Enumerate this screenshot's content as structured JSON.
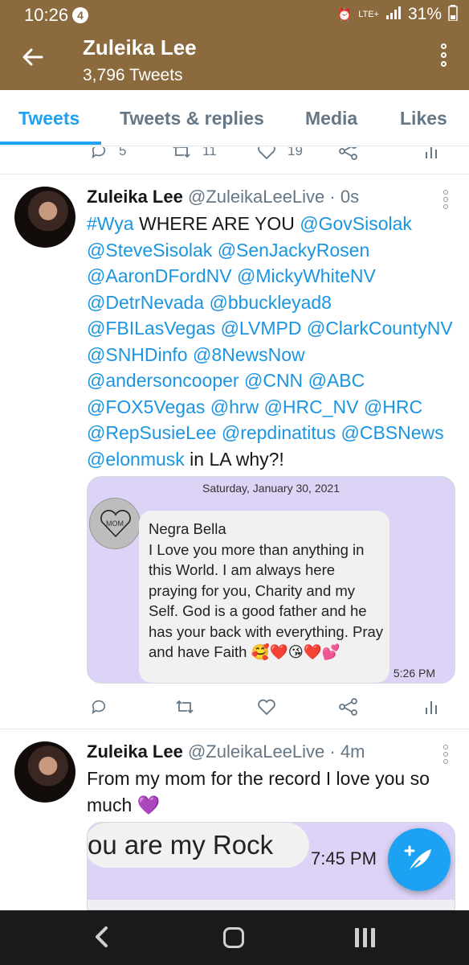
{
  "status_bar": {
    "time": "10:26",
    "notification_count": "4",
    "network": "LTE+",
    "battery": "31%"
  },
  "header": {
    "title": "Zuleika Lee",
    "subtitle": "3,796 Tweets"
  },
  "tabs": [
    {
      "label": "Tweets",
      "active": true
    },
    {
      "label": "Tweets & replies",
      "active": false
    },
    {
      "label": "Media",
      "active": false
    },
    {
      "label": "Likes",
      "active": false
    }
  ],
  "prev_tweet_actions": {
    "replies": "5",
    "retweets": "11",
    "likes": "19"
  },
  "tweet1": {
    "name": "Zuleika Lee",
    "handle": "@ZuleikaLeeLive",
    "time": "· 0s",
    "segments": [
      {
        "text": "#Wya",
        "link": true
      },
      {
        "text": " WHERE ARE YOU ",
        "link": false
      },
      {
        "text": "@GovSisolak",
        "link": true
      },
      {
        "text": " ",
        "link": false
      },
      {
        "text": "@SteveSisolak",
        "link": true
      },
      {
        "text": " ",
        "link": false
      },
      {
        "text": "@SenJackyRosen",
        "link": true
      },
      {
        "text": " ",
        "link": false
      },
      {
        "text": "@AaronDFordNV",
        "link": true
      },
      {
        "text": " ",
        "link": false
      },
      {
        "text": "@MickyWhiteNV",
        "link": true
      },
      {
        "text": " ",
        "link": false
      },
      {
        "text": "@DetrNevada",
        "link": true
      },
      {
        "text": " ",
        "link": false
      },
      {
        "text": "@bbuckleyad8",
        "link": true
      },
      {
        "text": " ",
        "link": false
      },
      {
        "text": "@FBILasVegas",
        "link": true
      },
      {
        "text": " ",
        "link": false
      },
      {
        "text": "@LVMPD",
        "link": true
      },
      {
        "text": " ",
        "link": false
      },
      {
        "text": "@ClarkCountyNV",
        "link": true
      },
      {
        "text": " ",
        "link": false
      },
      {
        "text": "@SNHDinfo",
        "link": true
      },
      {
        "text": " ",
        "link": false
      },
      {
        "text": "@8NewsNow",
        "link": true
      },
      {
        "text": " ",
        "link": false
      },
      {
        "text": "@andersoncooper",
        "link": true
      },
      {
        "text": " ",
        "link": false
      },
      {
        "text": "@CNN",
        "link": true
      },
      {
        "text": " ",
        "link": false
      },
      {
        "text": "@ABC",
        "link": true
      },
      {
        "text": " ",
        "link": false
      },
      {
        "text": "@FOX5Vegas",
        "link": true
      },
      {
        "text": " ",
        "link": false
      },
      {
        "text": "@hrw",
        "link": true
      },
      {
        "text": " ",
        "link": false
      },
      {
        "text": "@HRC_NV",
        "link": true
      },
      {
        "text": " ",
        "link": false
      },
      {
        "text": "@HRC",
        "link": true
      },
      {
        "text": " ",
        "link": false
      },
      {
        "text": "@RepSusieLee",
        "link": true
      },
      {
        "text": " ",
        "link": false
      },
      {
        "text": "@repdinatitus",
        "link": true
      },
      {
        "text": " ",
        "link": false
      },
      {
        "text": "@CBSNews",
        "link": true
      },
      {
        "text": " ",
        "link": false
      },
      {
        "text": "@elonmusk",
        "link": true
      },
      {
        "text": " in LA why?!",
        "link": false
      }
    ],
    "image": {
      "date": "Saturday, January 30, 2021",
      "avatar_label": "MOM",
      "message": "Negra Bella\nI Love you more than anything in this World. I am always here praying for you, Charity and my Self.  God is a good father and he has your back with everything. Pray and have Faith 🥰❤️😘❤️💕",
      "time": "5:26 PM"
    }
  },
  "tweet2": {
    "name": "Zuleika Lee",
    "handle": "@ZuleikaLeeLive",
    "time": "· 4m",
    "text": "From my mom for the record I love you so much 💜",
    "image": {
      "message": "ou are my Rock",
      "time": "7:45 PM"
    }
  },
  "colors": {
    "header_bg": "#8b6a3e",
    "accent": "#1da1f2",
    "link": "#1b95e0",
    "muted": "#657786",
    "card_bg": "#dcd3f6"
  },
  "icons": {
    "back": "arrow-left-icon",
    "menu": "more-vertical-icon",
    "compose": "compose-feather-icon"
  }
}
